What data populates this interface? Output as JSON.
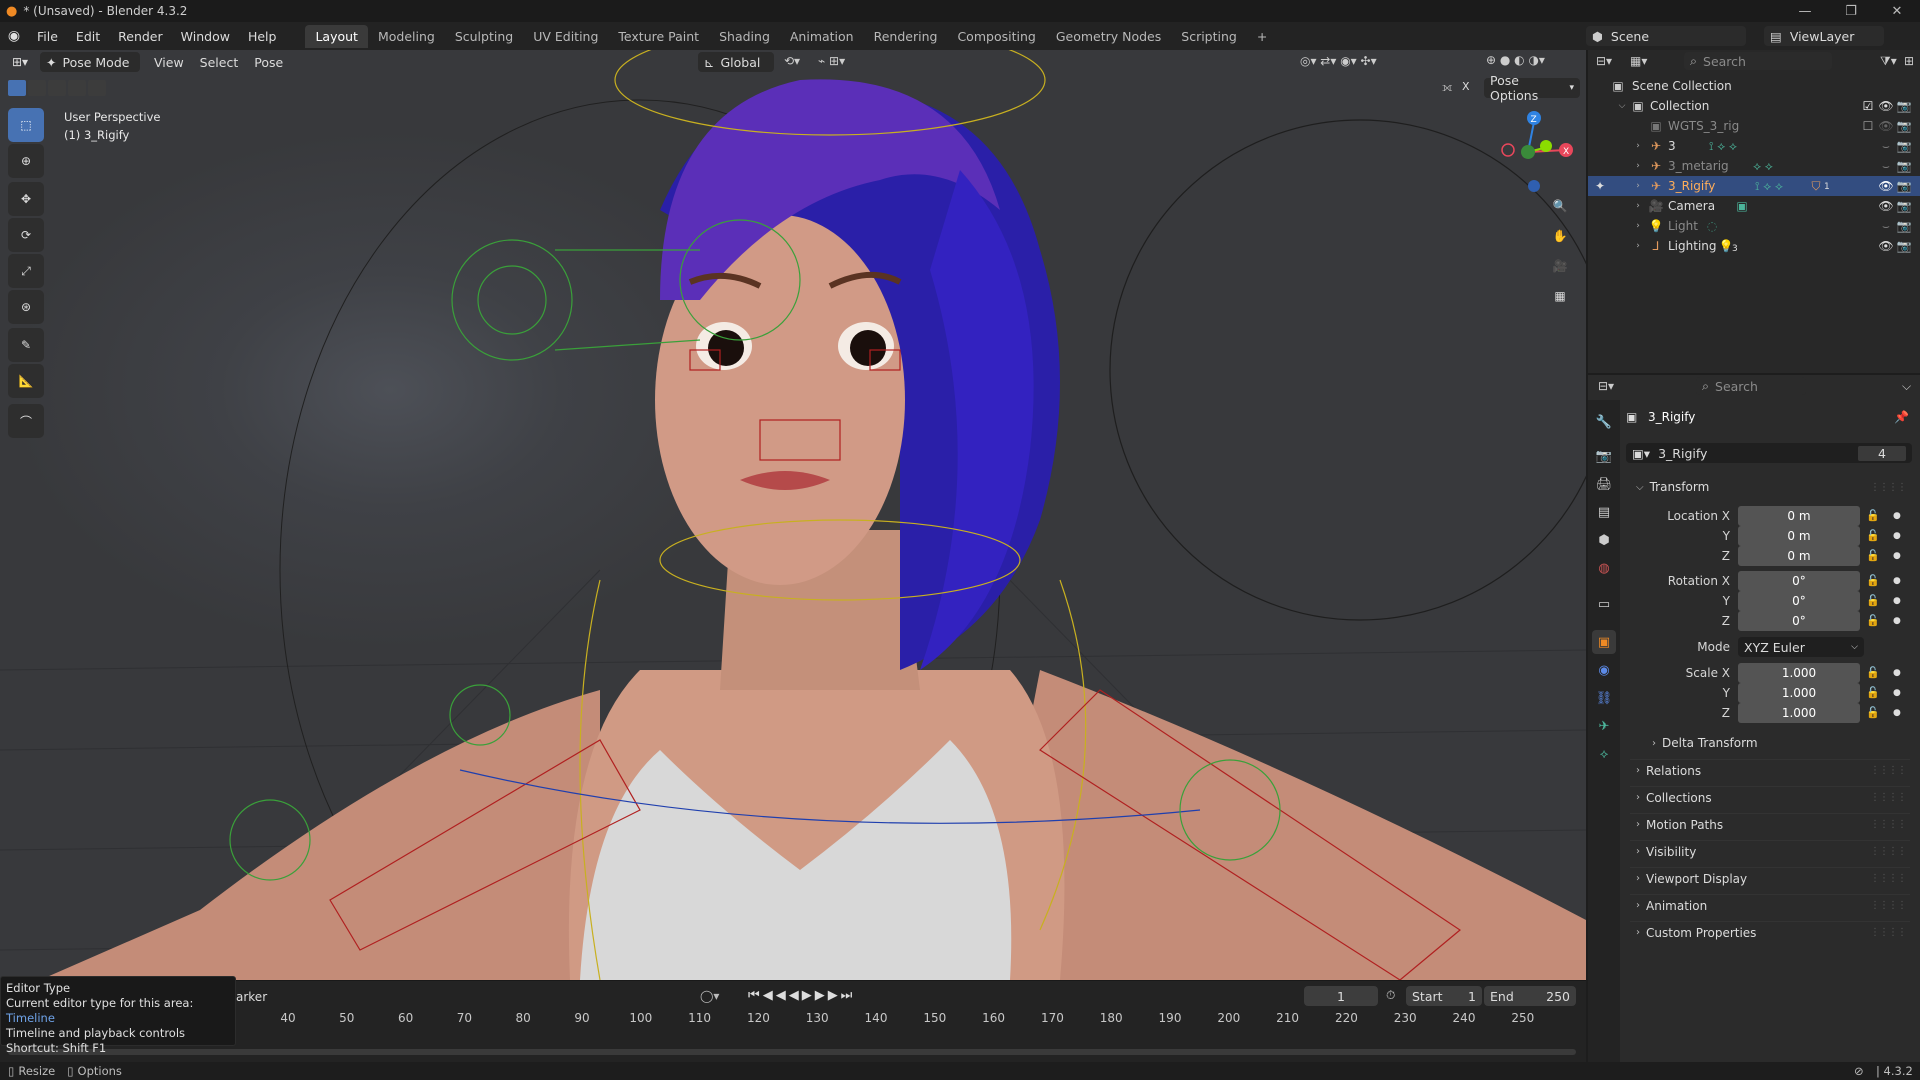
{
  "window": {
    "title": "* (Unsaved) - Blender 4.3.2",
    "controls": [
      "—",
      "❐",
      "✕"
    ]
  },
  "menus": [
    "File",
    "Edit",
    "Render",
    "Window",
    "Help"
  ],
  "workspaces": [
    "Layout",
    "Modeling",
    "Sculpting",
    "UV Editing",
    "Texture Paint",
    "Shading",
    "Animation",
    "Rendering",
    "Compositing",
    "Geometry Nodes",
    "Scripting"
  ],
  "active_workspace": "Layout",
  "add_workspace": "+",
  "scene": {
    "name": "Scene",
    "view_layer": "ViewLayer"
  },
  "viewport": {
    "mode": "Pose Mode",
    "header_menus": [
      "View",
      "Select",
      "Pose"
    ],
    "orientation": "Global",
    "overlay_title": "User Perspective",
    "overlay_object": "(1) 3_Rigify",
    "pose_options": "Pose Options",
    "x_mirror": "X",
    "gizmo_axes": {
      "z": "Z",
      "x": "X"
    }
  },
  "tools": [
    "select-box",
    "cursor",
    "move",
    "rotate",
    "scale",
    "transform",
    "annotate",
    "measure",
    "bone-relax"
  ],
  "timeline": {
    "marker_label": "arker",
    "current_frame": "1",
    "start_label": "Start",
    "start": "1",
    "end_label": "End",
    "end": "250",
    "ticks": [
      "40",
      "50",
      "60",
      "70",
      "80",
      "90",
      "100",
      "110",
      "120",
      "130",
      "140",
      "150",
      "160",
      "170",
      "180",
      "190",
      "200",
      "210",
      "220",
      "230",
      "240",
      "250"
    ]
  },
  "tooltip": {
    "title": "Editor Type",
    "line1_prefix": "Current editor type for this area: ",
    "line1_value": "Timeline",
    "line2": "Timeline and playback controls",
    "line3": "Shortcut: Shift F1"
  },
  "statusbar": {
    "resize": "Resize",
    "options": "Options",
    "version": "4.3.2"
  },
  "outliner": {
    "search_placeholder": "Search",
    "scene_collection": "Scene Collection",
    "collection": "Collection",
    "items": [
      {
        "name": "WGTS_3_rig",
        "dimmed": true
      },
      {
        "name": "3",
        "dimmed": false
      },
      {
        "name": "3_metarig",
        "dimmed": true
      },
      {
        "name": "3_Rigify",
        "dimmed": false,
        "selected": true
      },
      {
        "name": "Camera",
        "dimmed": false
      },
      {
        "name": "Light",
        "dimmed": true
      },
      {
        "name": "Lighting",
        "dimmed": false
      }
    ],
    "lighting_count": "3",
    "rigify_count": "1"
  },
  "properties": {
    "search_placeholder": "Search",
    "object_name": "3_Rigify",
    "data_name": "3_Rigify",
    "users": "4",
    "transform_title": "Transform",
    "location_label": "Location X",
    "rotation_label": "Rotation X",
    "scale_label": "Scale X",
    "y_label": "Y",
    "z_label": "Z",
    "location": [
      "0 m",
      "0 m",
      "0 m"
    ],
    "rotation": [
      "0°",
      "0°",
      "0°"
    ],
    "mode_label": "Mode",
    "mode": "XYZ Euler",
    "scale": [
      "1.000",
      "1.000",
      "1.000"
    ],
    "delta_transform": "Delta Transform",
    "panels": [
      "Relations",
      "Collections",
      "Motion Paths",
      "Visibility",
      "Viewport Display",
      "Animation",
      "Custom Properties"
    ]
  },
  "colors": {
    "accent": "#4772b3",
    "selected_row": "#334d80",
    "x_axis": "#e8475b",
    "y_axis": "#8bdc00",
    "z_axis": "#2f83e3",
    "tooltip_link": "#6fa3e8"
  }
}
